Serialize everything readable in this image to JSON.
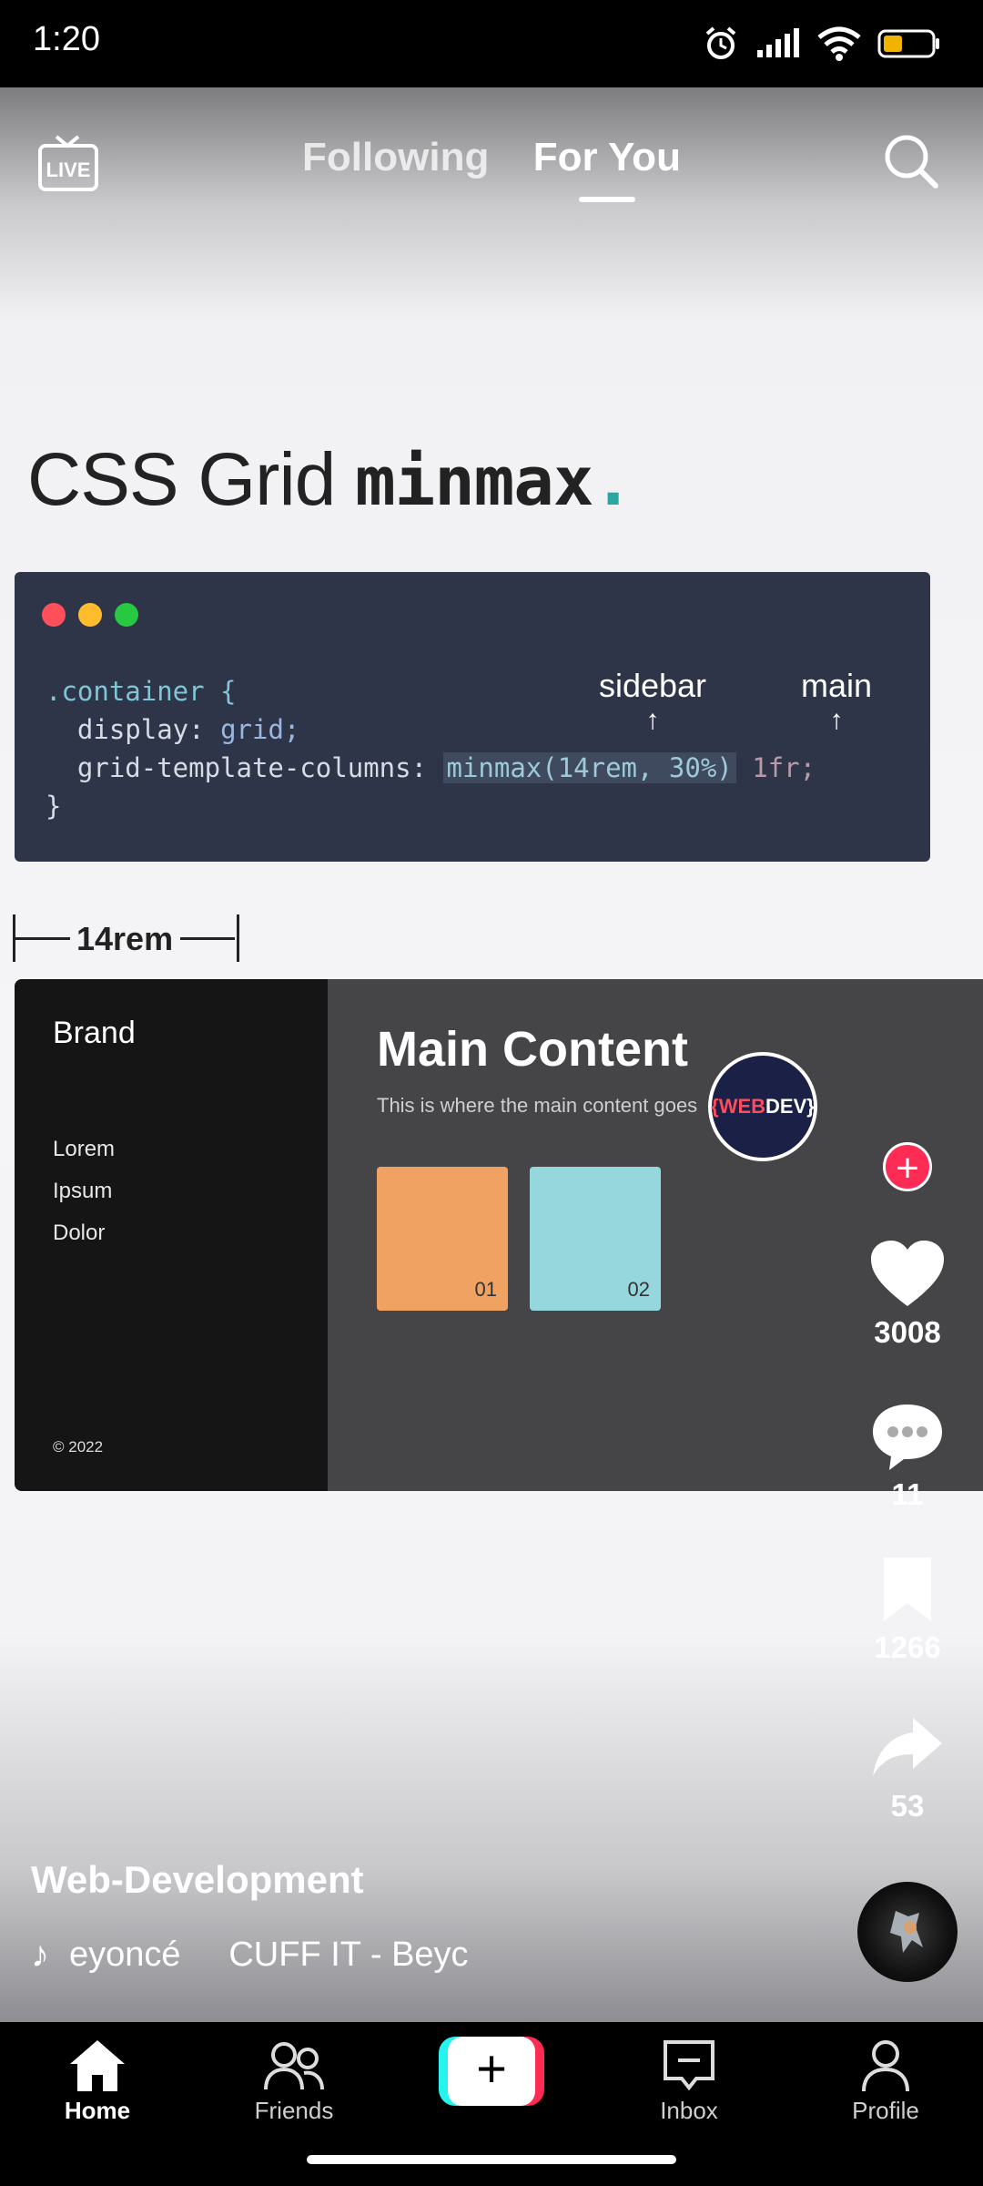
{
  "status_bar": {
    "time": "1:20"
  },
  "top_nav": {
    "live_label": "LIVE",
    "tabs": [
      {
        "label": "Following",
        "active": false
      },
      {
        "label": "For You",
        "active": true
      }
    ]
  },
  "slide": {
    "title_plain": "CSS Grid ",
    "title_mono": "minmax",
    "title_dot": ".",
    "code": {
      "line1": ".container {",
      "line2_prop": "  display: ",
      "line2_val": "grid;",
      "line3_prop": "  grid-template-columns: ",
      "line3_hl": "minmax(14rem, 30%)",
      "line3_rest": " 1fr;",
      "line4": "}"
    },
    "annotations": {
      "sidebar": "sidebar",
      "main": "main",
      "arrow": "↑"
    },
    "measure_label": "14rem",
    "demo": {
      "brand": "Brand",
      "menu": [
        "Lorem",
        "Ipsum",
        "Dolor"
      ],
      "copyright": "© 2022",
      "main_title": "Main Content",
      "main_subtitle": "This is where the main content goes",
      "cards": [
        {
          "label": "01",
          "color": "#f0a262"
        },
        {
          "label": "02",
          "color": "#96d7de"
        }
      ]
    }
  },
  "creator": {
    "avatar_text_a": "{WEB",
    "avatar_text_b": "DEV}"
  },
  "actions": {
    "likes": "3008",
    "comments": "11",
    "saves": "1266",
    "shares": "53"
  },
  "caption": {
    "author": "Web-Development",
    "music_a": "eyoncé",
    "music_b": "CUFF IT - Beyc"
  },
  "bottom_nav": {
    "home": "Home",
    "friends": "Friends",
    "create": "+",
    "inbox": "Inbox",
    "profile": "Profile"
  },
  "colors": {
    "accent_red": "#fe2c55",
    "accent_cyan": "#25f4ee",
    "code_bg": "#2f3548"
  }
}
